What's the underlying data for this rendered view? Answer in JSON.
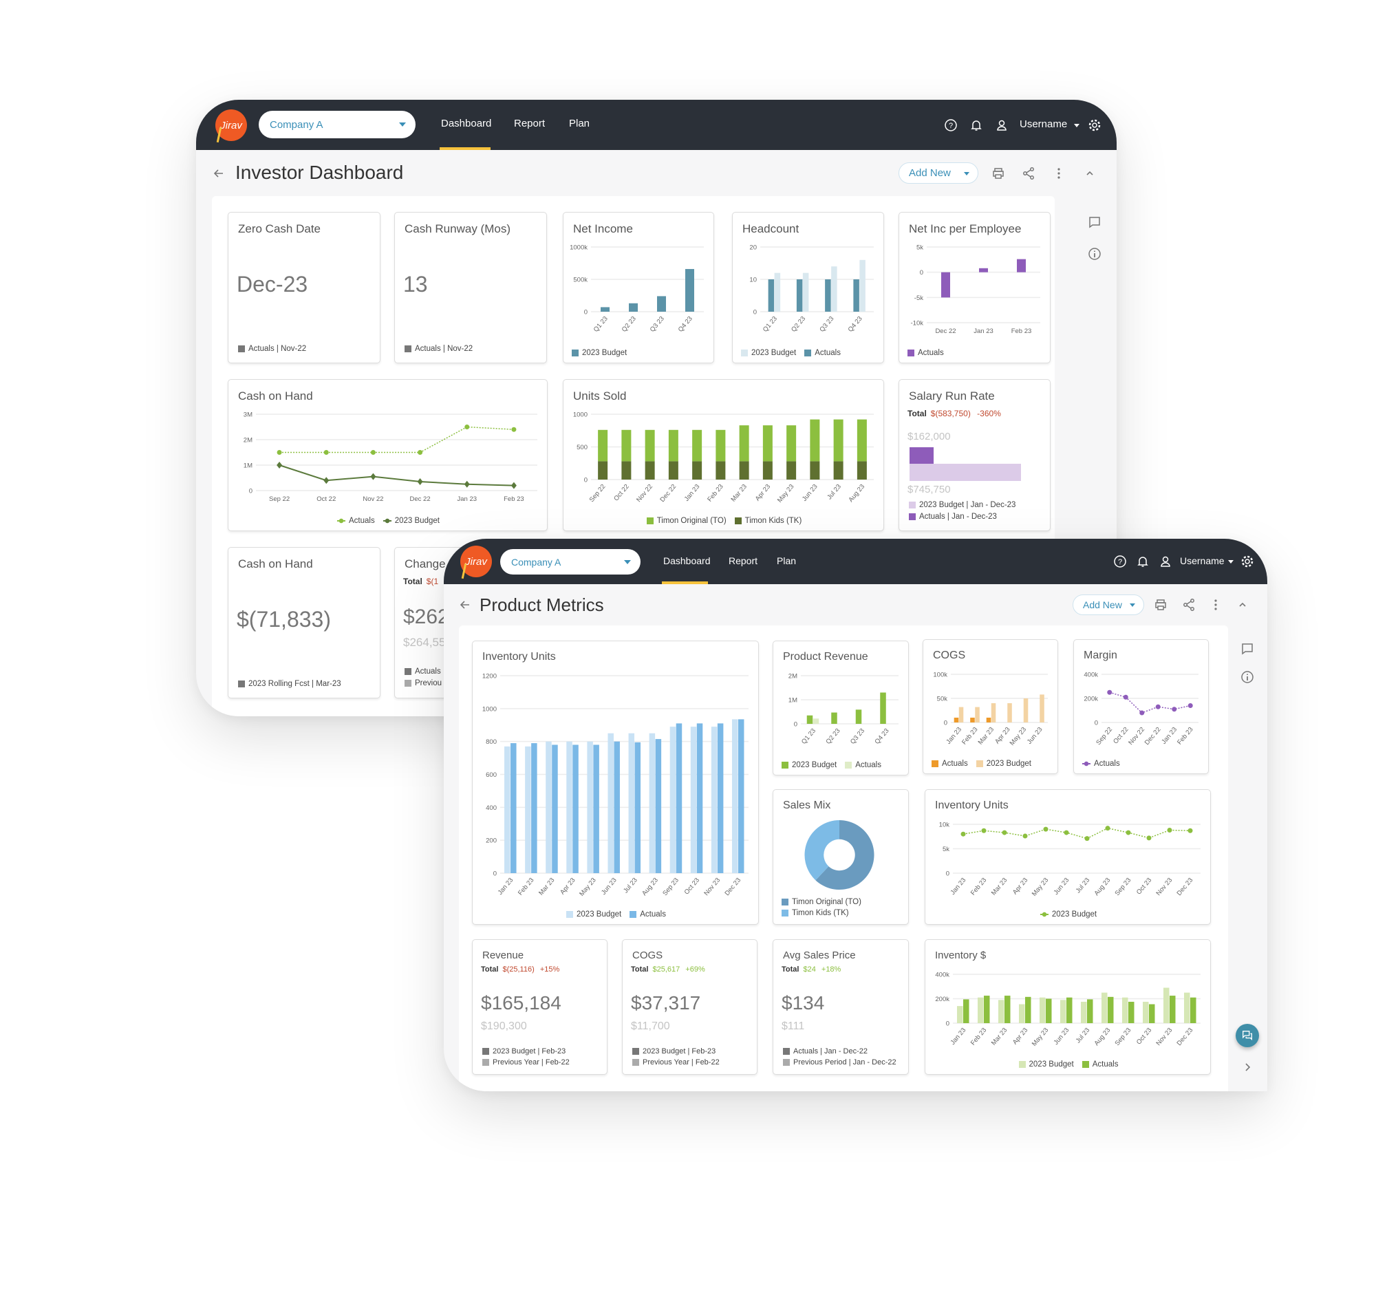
{
  "investor": {
    "logo_text": "Jirav",
    "company": "Company A",
    "nav": [
      "Dashboard",
      "Report",
      "Plan"
    ],
    "active_nav": "Dashboard",
    "username": "Username",
    "title": "Investor Dashboard",
    "add_new": "Add New",
    "cards": {
      "zero_cash": {
        "title": "Zero Cash Date",
        "value": "Dec-23",
        "legend": "Actuals | Nov-22"
      },
      "runway": {
        "title": "Cash Runway (Mos)",
        "value": "13",
        "legend": "Actuals | Nov-22"
      },
      "net_income": {
        "title": "Net Income"
      },
      "headcount": {
        "title": "Headcount"
      },
      "net_inc_emp": {
        "title": "Net Inc per Employee"
      },
      "cash_on_hand_chart": {
        "title": "Cash on Hand"
      },
      "units_sold": {
        "title": "Units Sold"
      },
      "salary": {
        "title": "Salary Run Rate",
        "total_label": "Total",
        "total_value": "$(583,750)",
        "total_pct": "-360%",
        "actual_label": "$162,000",
        "budget_label": "$745,750",
        "actual_value": 162000,
        "budget_value": 745750,
        "legend": [
          "2023 Budget | Jan - Dec-23",
          "Actuals | Jan - Dec-23"
        ],
        "colors": {
          "actual": "#8e5cba",
          "budget": "#dccbe8"
        }
      },
      "cash_on_hand_kpi": {
        "title": "Cash on Hand",
        "value": "$(71,833)",
        "legend": "2023 Rolling Fcst | Mar-23"
      },
      "change": {
        "title": "Change i",
        "total_label": "Total",
        "total_value": "$(1",
        "value": "$262",
        "compare_value": "$264,55",
        "legend": [
          "Actuals",
          "Previou"
        ]
      }
    }
  },
  "product": {
    "logo_text": "Jirav",
    "company": "Company A",
    "nav": [
      "Dashboard",
      "Report",
      "Plan"
    ],
    "active_nav": "Dashboard",
    "username": "Username",
    "title": "Product Metrics",
    "add_new": "Add New",
    "cards": {
      "inv_units_bar": {
        "title": "Inventory Units"
      },
      "product_revenue": {
        "title": "Product Revenue"
      },
      "cogs_chart": {
        "title": "COGS"
      },
      "margin": {
        "title": "Margin"
      },
      "sales_mix": {
        "title": "Sales Mix"
      },
      "inv_units_line": {
        "title": "Inventory Units"
      },
      "inventory_dollars": {
        "title": "Inventory $"
      },
      "revenue": {
        "title": "Revenue",
        "total_label": "Total",
        "total_value": "$(25,116)",
        "total_pct": "+15%",
        "value": "$165,184",
        "compare_value": "$190,300",
        "legend": [
          "2023 Budget | Feb-23",
          "Previous Year | Feb-22"
        ],
        "status": "negative"
      },
      "cogs_kpi": {
        "title": "COGS",
        "total_label": "Total",
        "total_value": "$25,617",
        "total_pct": "+69%",
        "value": "$37,317",
        "compare_value": "$11,700",
        "legend": [
          "2023 Budget | Feb-23",
          "Previous Year | Feb-22"
        ],
        "status": "positive"
      },
      "avg_price": {
        "title": "Avg Sales Price",
        "total_label": "Total",
        "total_value": "$24",
        "total_pct": "+18%",
        "value": "$134",
        "compare_value": "$111",
        "legend": [
          "Actuals | Jan - Dec-22",
          "Previous Period | Jan - Dec-22"
        ],
        "status": "positive"
      }
    }
  },
  "colors": {
    "header": "#2b3038",
    "accent": "#f6c23c",
    "brand": "#ef5a24",
    "link": "#3a8fb7",
    "negative": "#c0492f",
    "positive": "#8cbf3f"
  },
  "chart_data": [
    {
      "key": "net_income",
      "type": "bar",
      "categories": [
        "Q1 23",
        "Q2 23",
        "Q3 23",
        "Q4 23"
      ],
      "xrot": true,
      "ylim": [
        0,
        1000000
      ],
      "yticks": [
        {
          "v": 0,
          "label": "0"
        },
        {
          "v": 500000,
          "label": "500k"
        },
        {
          "v": 1000000,
          "label": "1000k"
        }
      ],
      "series": [
        {
          "name": "2023 Budget",
          "color": "#5b93a8",
          "values": [
            70000,
            130000,
            240000,
            660000
          ]
        }
      ],
      "legend": "left"
    },
    {
      "key": "headcount",
      "type": "bar",
      "categories": [
        "Q1 23",
        "Q2 23",
        "Q3 23",
        "Q4 23"
      ],
      "xrot": true,
      "ylim": [
        0,
        20
      ],
      "yticks": [
        {
          "v": 0,
          "label": "0"
        },
        {
          "v": 10,
          "label": "10"
        },
        {
          "v": 20,
          "label": "20"
        }
      ],
      "series": [
        {
          "name": "Actuals",
          "color": "#5b93a8",
          "values": [
            10,
            10,
            10,
            10
          ]
        },
        {
          "name": "2023 Budget",
          "color": "#d9e8ef",
          "values": [
            12,
            12,
            14,
            16
          ]
        }
      ],
      "legend_order": [
        1,
        0
      ],
      "legend": "left"
    },
    {
      "key": "net_inc_emp",
      "type": "bar",
      "categories": [
        "Dec 22",
        "Jan 23",
        "Feb 23"
      ],
      "xrot": false,
      "ylim": [
        -10000,
        5000
      ],
      "yticks": [
        {
          "v": 5000,
          "label": "5k"
        },
        {
          "v": 0,
          "label": "0"
        },
        {
          "v": -5000,
          "label": "-5k"
        },
        {
          "v": -10000,
          "label": "-10k"
        }
      ],
      "series": [
        {
          "name": "Actuals",
          "color": "#8e5cba",
          "values": [
            -5000,
            800,
            2600
          ]
        }
      ],
      "legend": "left"
    },
    {
      "key": "cash_on_hand_chart",
      "type": "line",
      "categories": [
        "Sep 22",
        "Oct 22",
        "Nov 22",
        "Dec 22",
        "Jan 23",
        "Feb 23"
      ],
      "xrot": false,
      "ylim": [
        0,
        3000000
      ],
      "yticks": [
        {
          "v": 0,
          "label": "0"
        },
        {
          "v": 1000000,
          "label": "1M"
        },
        {
          "v": 2000000,
          "label": "2M"
        },
        {
          "v": 3000000,
          "label": "3M"
        }
      ],
      "series": [
        {
          "name": "Actuals",
          "color": "#8cbf3f",
          "marker": "circle",
          "dotted": true,
          "values": [
            1500000,
            1500000,
            1500000,
            1500000,
            2500000,
            2400000
          ]
        },
        {
          "name": "2023 Budget",
          "color": "#5b7a3c",
          "marker": "diamond",
          "dotted": false,
          "values": [
            1000000,
            400000,
            550000,
            350000,
            250000,
            200000
          ]
        }
      ],
      "legend": "center"
    },
    {
      "key": "units_sold",
      "type": "bar",
      "stacked": true,
      "categories": [
        "Sep 22",
        "Oct 22",
        "Nov 22",
        "Dec 22",
        "Jan 23",
        "Feb 23",
        "Mar 23",
        "Apr 23",
        "May 23",
        "Jun 23",
        "Jul 23",
        "Aug 23"
      ],
      "xrot": true,
      "ylim": [
        0,
        1000
      ],
      "yticks": [
        {
          "v": 0,
          "label": "0"
        },
        {
          "v": 500,
          "label": "500"
        },
        {
          "v": 1000,
          "label": "1000"
        }
      ],
      "series": [
        {
          "name": "Timon Kids (TK)",
          "color": "#5f7030",
          "values": [
            280,
            280,
            280,
            280,
            280,
            280,
            280,
            280,
            280,
            280,
            280,
            280
          ]
        },
        {
          "name": "Timon Original (TO)",
          "color": "#8cbf3f",
          "values": [
            480,
            480,
            480,
            480,
            480,
            480,
            550,
            550,
            550,
            640,
            640,
            640
          ]
        }
      ],
      "legend_order": [
        1,
        0
      ],
      "legend": "center"
    },
    {
      "key": "inv_units_bar",
      "type": "bar",
      "categories": [
        "Jan 23",
        "Feb 23",
        "Mar 23",
        "Apr 23",
        "May 23",
        "Jun 23",
        "Jul 23",
        "Aug 23",
        "Sep 23",
        "Oct 23",
        "Nov 23",
        "Dec 23"
      ],
      "xrot": true,
      "ylim": [
        0,
        1200
      ],
      "yticks": [
        {
          "v": 0,
          "label": "0"
        },
        {
          "v": 200,
          "label": "200"
        },
        {
          "v": 400,
          "label": "400"
        },
        {
          "v": 600,
          "label": "600"
        },
        {
          "v": 800,
          "label": "800"
        },
        {
          "v": 1000,
          "label": "1000"
        },
        {
          "v": 1200,
          "label": "1200"
        }
      ],
      "series": [
        {
          "name": "2023 Budget",
          "color": "#c9e2f5",
          "values": [
            770,
            770,
            800,
            800,
            800,
            850,
            850,
            850,
            890,
            890,
            890,
            935
          ]
        },
        {
          "name": "Actuals",
          "color": "#7ab8e6",
          "values": [
            790,
            790,
            780,
            780,
            780,
            800,
            795,
            815,
            910,
            910,
            910,
            935
          ]
        }
      ],
      "legend": "center"
    },
    {
      "key": "product_revenue",
      "type": "bar",
      "categories": [
        "Q1 23",
        "Q2 23",
        "Q3 23",
        "Q4 23"
      ],
      "xrot": true,
      "ylim": [
        0,
        2000000
      ],
      "yticks": [
        {
          "v": 0,
          "label": "0"
        },
        {
          "v": 1000000,
          "label": "1M"
        },
        {
          "v": 2000000,
          "label": "2M"
        }
      ],
      "series": [
        {
          "name": "2023 Budget",
          "color": "#8cbf3f",
          "values": [
            350000,
            470000,
            590000,
            1300000
          ]
        },
        {
          "name": "Actuals",
          "color": "#dfecc7",
          "values": [
            220000,
            0,
            0,
            0
          ]
        }
      ],
      "legend": "left"
    },
    {
      "key": "cogs_chart",
      "type": "bar",
      "categories": [
        "Jan 23",
        "Feb 23",
        "Mar 23",
        "Apr 23",
        "May 23",
        "Jun 23"
      ],
      "xrot": true,
      "ylim": [
        0,
        100000
      ],
      "yticks": [
        {
          "v": 0,
          "label": "0"
        },
        {
          "v": 50000,
          "label": "50k"
        },
        {
          "v": 100000,
          "label": "100k"
        }
      ],
      "series": [
        {
          "name": "Actuals",
          "color": "#ee9a2a",
          "values": [
            10000,
            10000,
            10000,
            0,
            0,
            0
          ]
        },
        {
          "name": "2023 Budget",
          "color": "#f3d3a3",
          "values": [
            32000,
            32000,
            40000,
            40000,
            50000,
            58000
          ]
        }
      ],
      "legend": "left"
    },
    {
      "key": "margin",
      "type": "line",
      "categories": [
        "Sep 22",
        "Oct 22",
        "Nov 22",
        "Dec 22",
        "Jan 23",
        "Feb 23"
      ],
      "xrot": true,
      "ylim": [
        0,
        400000
      ],
      "yticks": [
        {
          "v": 0,
          "label": "0"
        },
        {
          "v": 200000,
          "label": "200k"
        },
        {
          "v": 400000,
          "label": "400k"
        }
      ],
      "series": [
        {
          "name": "Actuals",
          "color": "#8e5cba",
          "marker": "circle",
          "dotted": true,
          "values": [
            250000,
            210000,
            80000,
            130000,
            110000,
            140000
          ]
        }
      ],
      "legend": "left"
    },
    {
      "key": "sales_mix",
      "type": "donut",
      "series": [
        {
          "name": "Timon Original (TO)",
          "color": "#6a9bbf",
          "value": 62
        },
        {
          "name": "Timon Kids (TK)",
          "color": "#7dbbe6",
          "value": 38
        }
      ],
      "legend": "stack"
    },
    {
      "key": "inv_units_line",
      "type": "line",
      "categories": [
        "Jan 23",
        "Feb 23",
        "Mar 23",
        "Apr 23",
        "May 23",
        "Jun 23",
        "Jul 23",
        "Aug 23",
        "Sep 23",
        "Oct 23",
        "Nov 23",
        "Dec 23"
      ],
      "xrot": true,
      "ylim": [
        0,
        10000
      ],
      "yticks": [
        {
          "v": 0,
          "label": "0"
        },
        {
          "v": 5000,
          "label": "5k"
        },
        {
          "v": 10000,
          "label": "10k"
        }
      ],
      "series": [
        {
          "name": "2023 Budget",
          "color": "#8cbf3f",
          "marker": "circle",
          "dotted": true,
          "values": [
            8000,
            8700,
            8300,
            7600,
            9000,
            8300,
            7100,
            9200,
            8300,
            7200,
            8800,
            8700
          ]
        }
      ],
      "legend": "center"
    },
    {
      "key": "inventory_dollars",
      "type": "bar",
      "categories": [
        "Jan 23",
        "Feb 23",
        "Mar 23",
        "Apr 23",
        "May 23",
        "Jun 23",
        "Jul 23",
        "Aug 23",
        "Sep 23",
        "Oct 23",
        "Nov 23",
        "Dec 23"
      ],
      "xrot": true,
      "ylim": [
        0,
        400000
      ],
      "yticks": [
        {
          "v": 0,
          "label": "0"
        },
        {
          "v": 200000,
          "label": "200k"
        },
        {
          "v": 400000,
          "label": "400k"
        }
      ],
      "series": [
        {
          "name": "2023 Budget",
          "color": "#d6e7b5",
          "values": [
            140000,
            210000,
            190000,
            155000,
            210000,
            190000,
            175000,
            250000,
            210000,
            175000,
            290000,
            250000
          ]
        },
        {
          "name": "Actuals",
          "color": "#8cbf3f",
          "values": [
            195000,
            225000,
            225000,
            215000,
            200000,
            210000,
            195000,
            215000,
            175000,
            155000,
            225000,
            210000
          ]
        }
      ],
      "legend": "center"
    }
  ]
}
